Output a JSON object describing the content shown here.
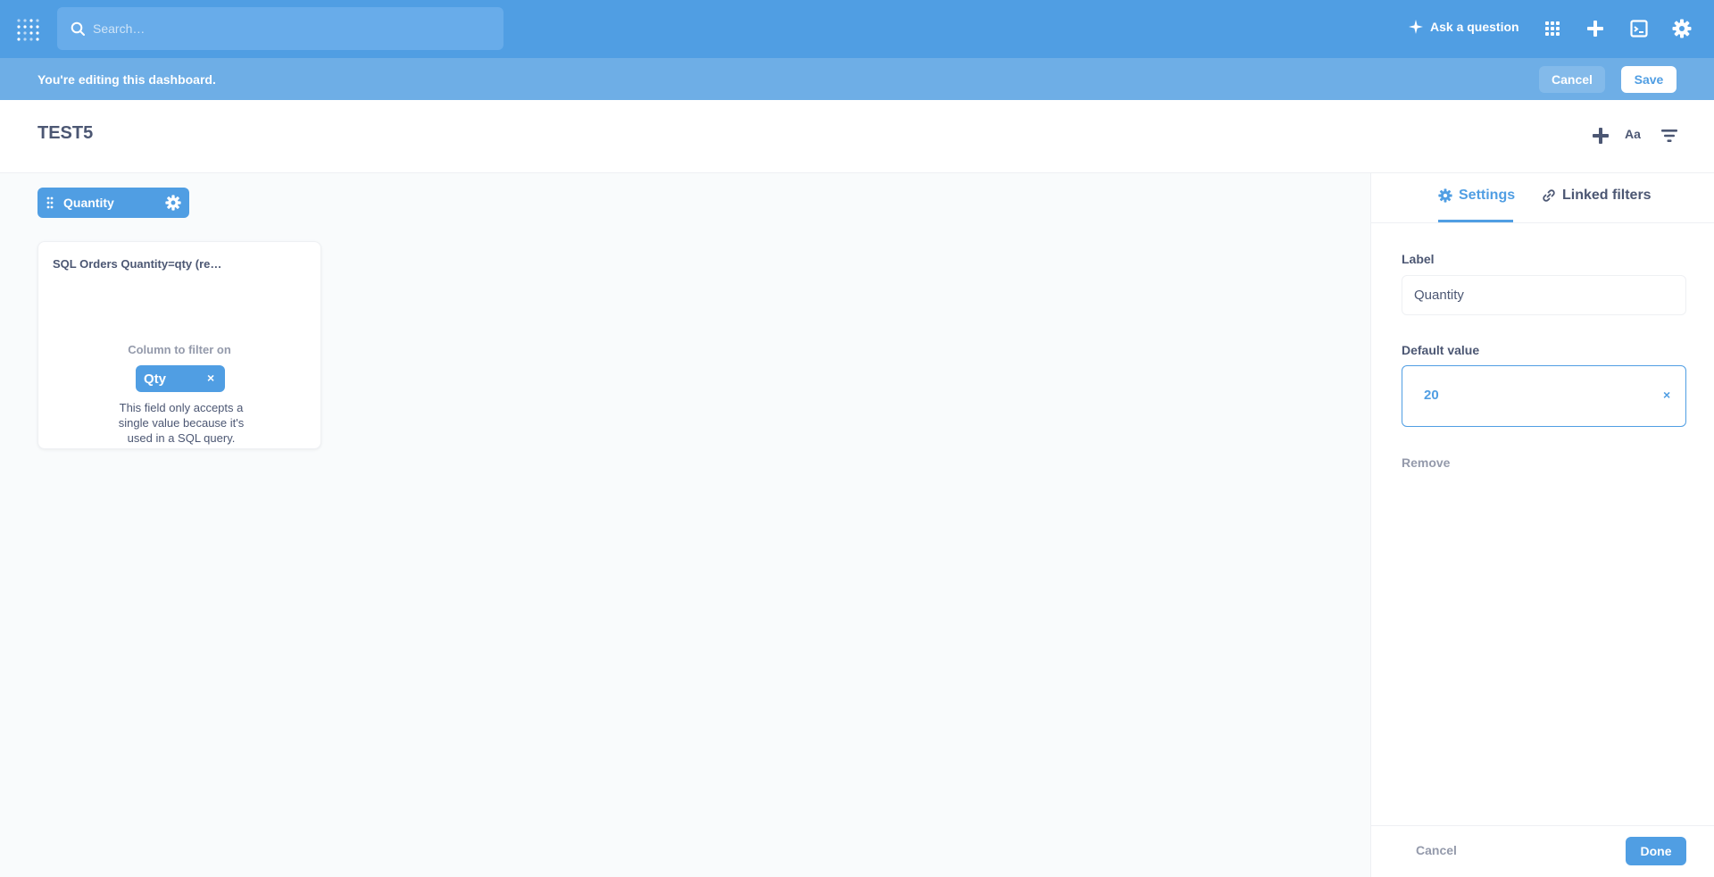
{
  "topnav": {
    "search_placeholder": "Search…",
    "ask_label": "Ask a question",
    "icons": [
      "metabase-logo-icon",
      "search-icon",
      "sparkle-icon",
      "grid-icon",
      "plus-icon",
      "notebook-icon",
      "gear-icon"
    ]
  },
  "banner": {
    "message": "You're editing this dashboard.",
    "cancel_label": "Cancel",
    "save_label": "Save"
  },
  "dashboard": {
    "title": "TEST5",
    "header_actions": [
      "add-card-icon",
      "text-card-label",
      "filter-icon"
    ],
    "text_action_label": "Aa"
  },
  "filter_chip": {
    "label": "Quantity"
  },
  "card": {
    "title": "SQL Orders Quantity=qty (re…",
    "column_label": "Column to filter on",
    "column_value": "Qty",
    "remove_glyph": "×",
    "note": "This field only accepts a single value because it's used in a SQL query."
  },
  "sidebar": {
    "tabs": [
      {
        "label": "Settings",
        "icon": "gear-icon",
        "active": true
      },
      {
        "label": "Linked filters",
        "icon": "link-icon",
        "active": false
      }
    ],
    "label_field": {
      "label": "Label",
      "value": "Quantity"
    },
    "default_value": {
      "label": "Default value",
      "value": "20",
      "clear_glyph": "×"
    },
    "remove_label": "Remove",
    "cancel_label": "Cancel",
    "done_label": "Done"
  },
  "colors": {
    "brand": "#509ee3",
    "banner": "#6eaee6",
    "text_dark": "#4c5773",
    "text_light": "#949aab",
    "background": "#f9fbfc"
  }
}
